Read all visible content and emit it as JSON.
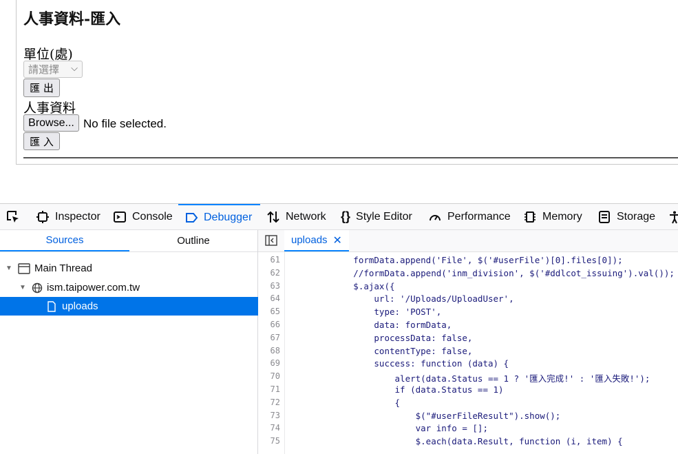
{
  "page": {
    "title": "人事資料-匯入",
    "unit_label": "單位(處)",
    "unit_select": "請選擇",
    "export_button": "匯 出",
    "hr_label": "人事資料",
    "browse_button": "Browse...",
    "file_status": "No file selected.",
    "import_button": "匯 入"
  },
  "devtools": {
    "tabs": [
      "Inspector",
      "Console",
      "Debugger",
      "Network",
      "Style Editor",
      "Performance",
      "Memory",
      "Storage"
    ],
    "active_tab": "Debugger",
    "sources_tab": "Sources",
    "outline_tab": "Outline",
    "tree": {
      "thread": "Main Thread",
      "domain": "ism.taipower.com.tw",
      "file": "uploads"
    },
    "editor_tab": "uploads",
    "code": [
      {
        "n": "61",
        "t": "            formData.append('File', $('#userFile')[0].files[0]);"
      },
      {
        "n": "62",
        "t": "            //formData.append('inm_division', $('#ddlcot_issuing').val());"
      },
      {
        "n": "63",
        "t": "            $.ajax({"
      },
      {
        "n": "64",
        "t": "                url: '/Uploads/UploadUser',"
      },
      {
        "n": "65",
        "t": "                type: 'POST',"
      },
      {
        "n": "66",
        "t": "                data: formData,"
      },
      {
        "n": "67",
        "t": "                processData: false,"
      },
      {
        "n": "68",
        "t": "                contentType: false,"
      },
      {
        "n": "69",
        "t": "                success: function (data) {"
      },
      {
        "n": "70",
        "t": "                    alert(data.Status == 1 ? '匯入完成!' : '匯入失敗!');"
      },
      {
        "n": "71",
        "t": "                    if (data.Status == 1)"
      },
      {
        "n": "72",
        "t": "                    {"
      },
      {
        "n": "73",
        "t": "                        $(\"#userFileResult\").show();"
      },
      {
        "n": "74",
        "t": "                        var info = [];"
      },
      {
        "n": "75",
        "t": "                        $.each(data.Result, function (i, item) {"
      }
    ]
  }
}
